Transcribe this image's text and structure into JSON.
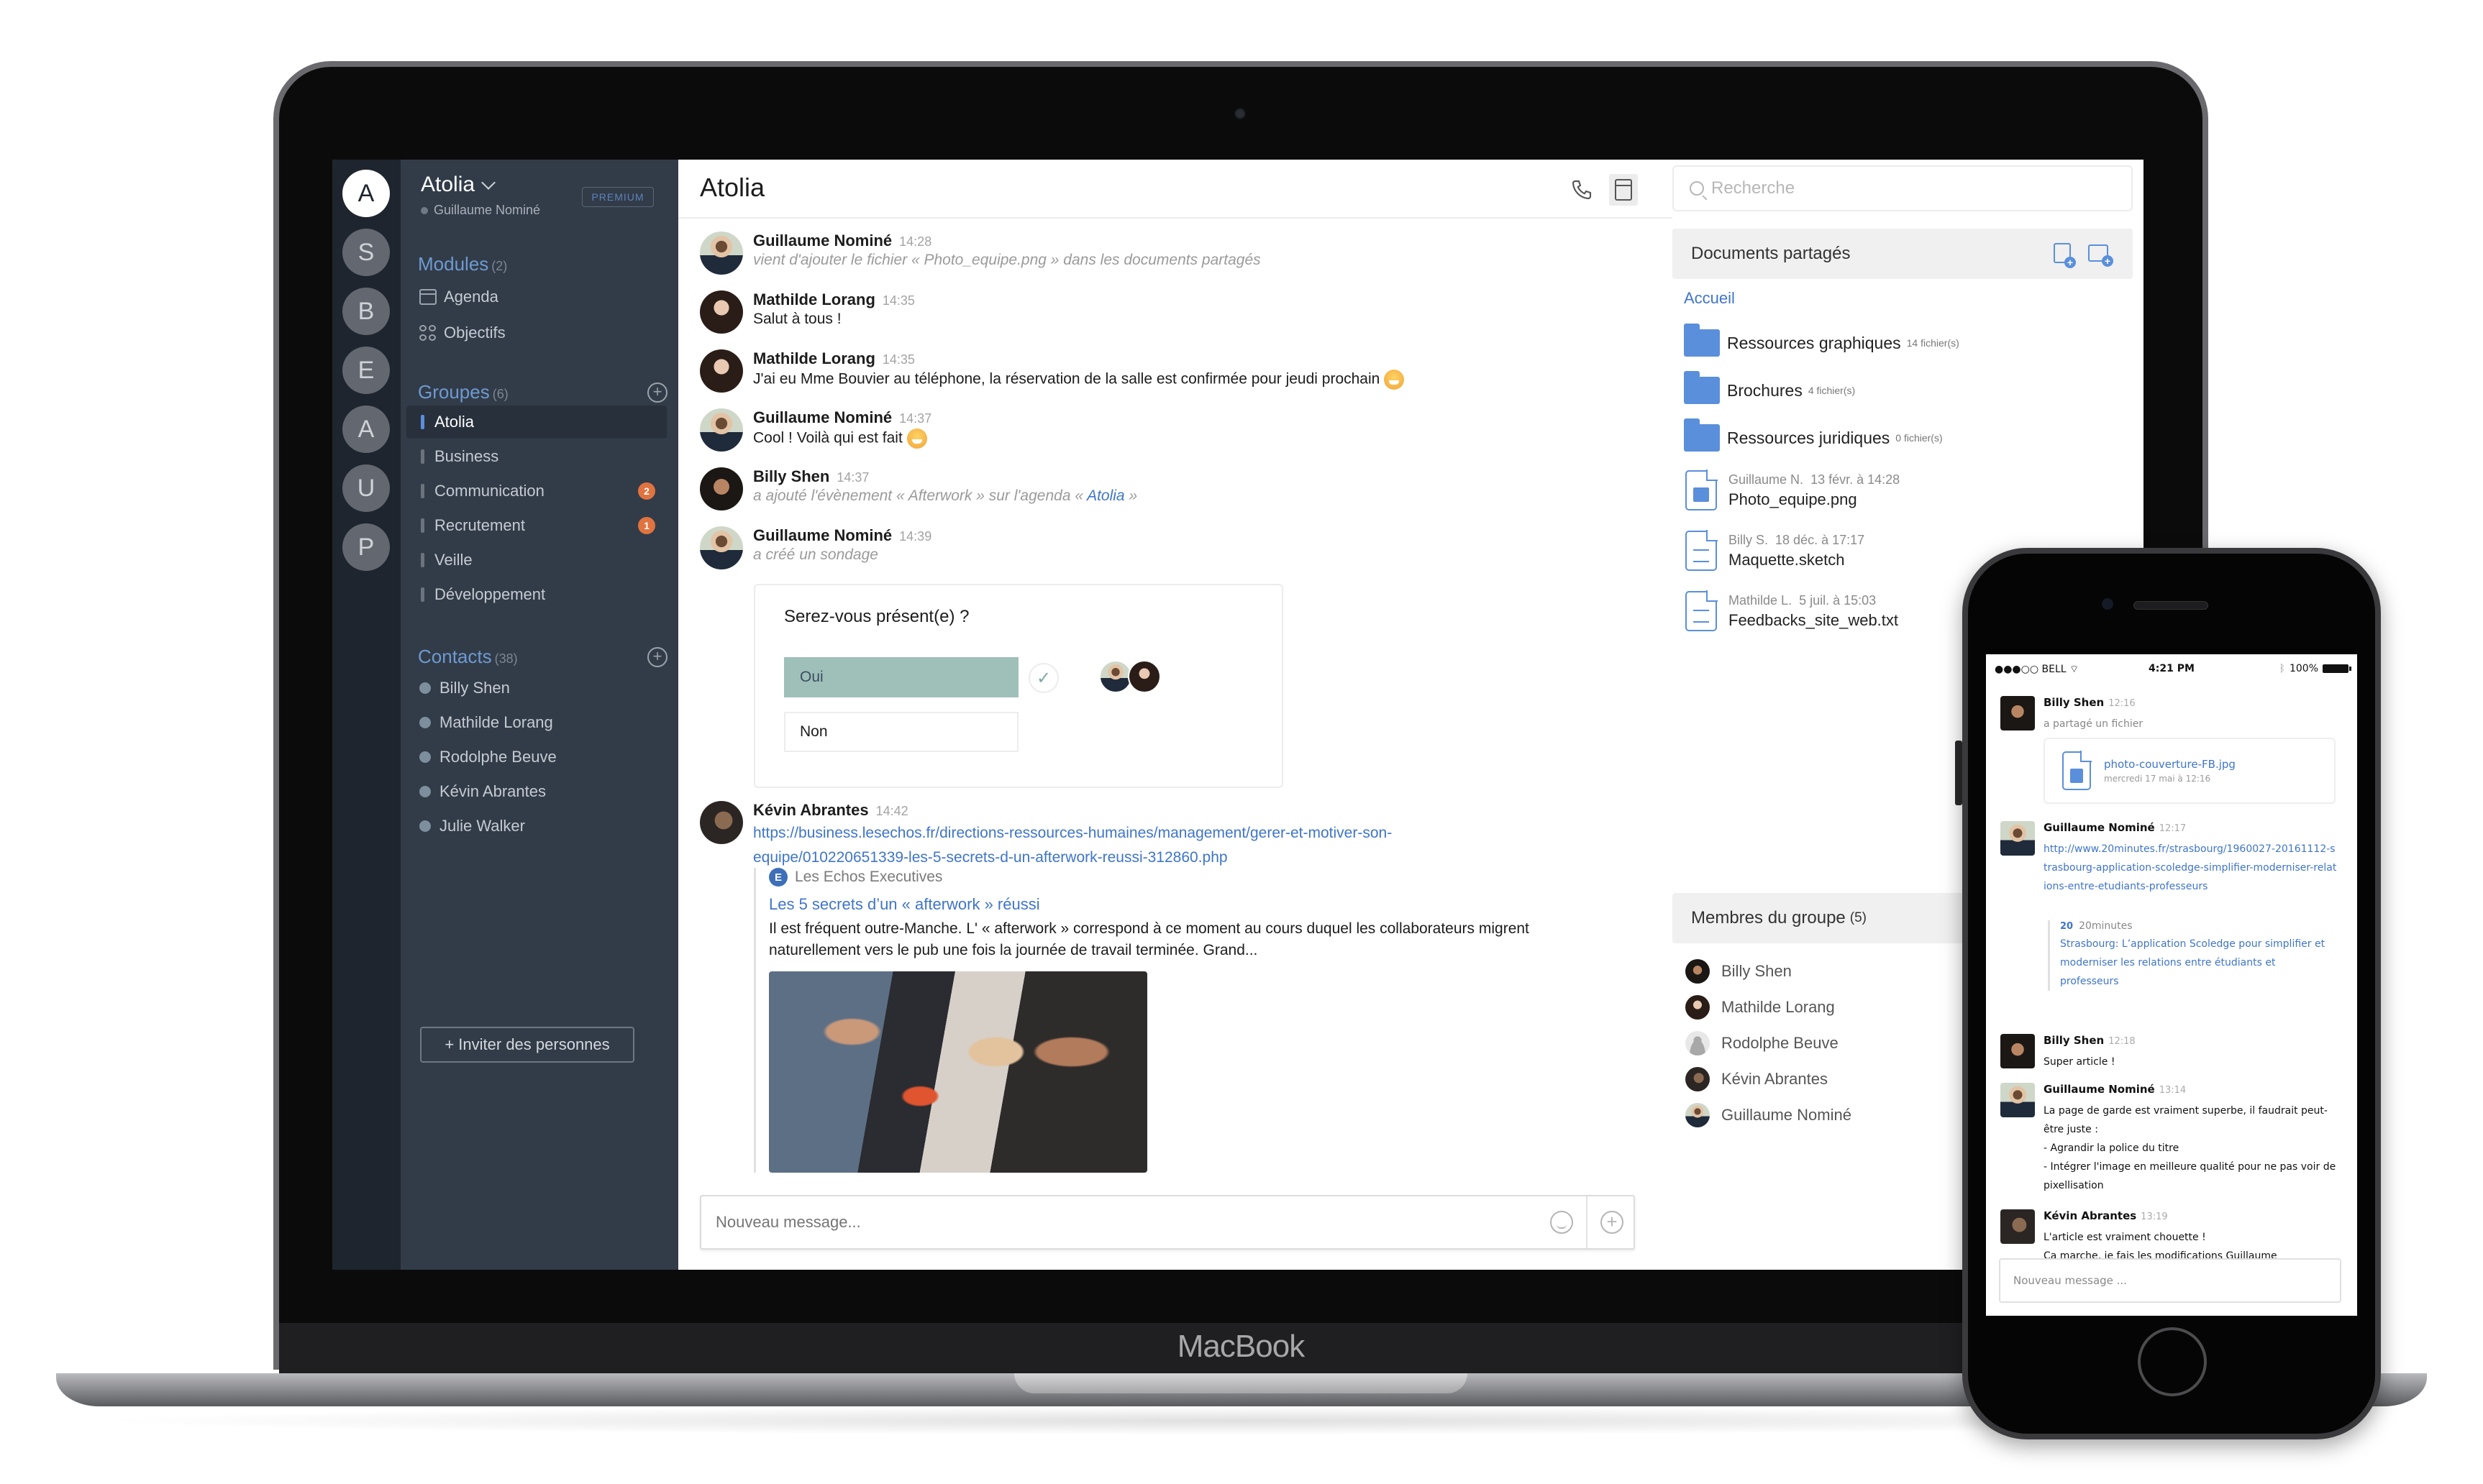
{
  "device": {
    "laptop_label": "MacBook"
  },
  "rail": {
    "workspaces": [
      "A",
      "S",
      "B",
      "E",
      "A",
      "U",
      "P"
    ],
    "active_index": 0
  },
  "sidebar": {
    "workspace_name": "Atolia",
    "user_name": "Guillaume Nominé",
    "plan_badge": "PREMIUM",
    "modules": {
      "title": "Modules",
      "count": "(2)",
      "items": [
        {
          "label": "Agenda",
          "icon": "calendar-icon"
        },
        {
          "label": "Objectifs",
          "icon": "grid-icon"
        }
      ]
    },
    "groups": {
      "title": "Groupes",
      "count": "(6)",
      "items": [
        {
          "label": "Atolia",
          "active": true,
          "badge": null
        },
        {
          "label": "Business",
          "badge": null
        },
        {
          "label": "Communication",
          "badge": "2"
        },
        {
          "label": "Recrutement",
          "badge": "1"
        },
        {
          "label": "Veille",
          "badge": null
        },
        {
          "label": "Développement",
          "badge": null
        }
      ]
    },
    "contacts": {
      "title": "Contacts",
      "count": "(38)",
      "items": [
        "Billy Shen",
        "Mathilde Lorang",
        "Rodolphe Beuve",
        "Kévin Abrantes",
        "Julie Walker"
      ]
    },
    "invite_label": "+ Inviter des personnes"
  },
  "chat": {
    "title": "Atolia",
    "messages": [
      {
        "author": "Guillaume Nominé",
        "time": "14:28",
        "text": "vient d'ajouter le fichier « Photo_equipe.png » dans les documents partagés",
        "system": true
      },
      {
        "author": "Mathilde Lorang",
        "time": "14:35",
        "text": "Salut à tous !"
      },
      {
        "author": "Mathilde Lorang",
        "time": "14:35",
        "text": "J'ai eu Mme Bouvier au téléphone, la réservation de la salle est confirmée pour jeudi prochain"
      },
      {
        "author": "Guillaume Nominé",
        "time": "14:37",
        "text": "Cool ! Voilà qui est fait"
      },
      {
        "author": "Billy Shen",
        "time": "14:37",
        "text_before": "a ajouté l'évènement « Afterwork » sur l'agenda « ",
        "link": "Atolia",
        "text_after": " »",
        "system": true
      },
      {
        "author": "Guillaume Nominé",
        "time": "14:39",
        "text": "a créé un sondage",
        "system": true
      },
      {
        "author": "Kévin Abrantes",
        "time": "14:42",
        "url_line1": "https://business.lesechos.fr/directions-ressources-humaines/management/gerer-et-motiver-son-",
        "url_line2": "equipe/010220651339-les-5-secrets-d-un-afterwork-reussi-312860.php"
      }
    ],
    "poll": {
      "question": "Serez-vous présent(e) ?",
      "options": [
        {
          "label": "Oui",
          "selected": true,
          "voters": 2
        },
        {
          "label": "Non",
          "selected": false,
          "voters": 0
        }
      ]
    },
    "link_preview": {
      "source_logo": "E",
      "source": "Les Echos Executives",
      "title": "Les 5 secrets d’un « afterwork » réussi",
      "description": "Il est fréquent outre-Manche. L' « afterwork » correspond à ce moment au cours duquel les collaborateurs migrent naturellement vers le pub une fois la journée de travail terminée. Grand..."
    },
    "composer_placeholder": "Nouveau message..."
  },
  "right_panel": {
    "search_placeholder": "Recherche",
    "documents": {
      "title": "Documents partagés",
      "breadcrumb": "Accueil",
      "folders": [
        {
          "name": "Ressources graphiques",
          "count": "14 fichier(s)"
        },
        {
          "name": "Brochures",
          "count": "4 fichier(s)"
        },
        {
          "name": "Ressources juridiques",
          "count": "0 fichier(s)"
        }
      ],
      "files": [
        {
          "author": "Guillaume N.",
          "date": "13 févr. à 14:28",
          "name": "Photo_equipe.png",
          "type": "image"
        },
        {
          "author": "Billy S.",
          "date": "18 déc. à 17:17",
          "name": "Maquette.sketch",
          "type": "text"
        },
        {
          "author": "Mathilde L.",
          "date": "5 juil. à 15:03",
          "name": "Feedbacks_site_web.txt",
          "type": "text"
        }
      ]
    },
    "members": {
      "title": "Membres du groupe",
      "count": "(5)",
      "items": [
        "Billy Shen",
        "Mathilde Lorang",
        "Rodolphe Beuve",
        "Kévin Abrantes",
        "Guillaume Nominé"
      ]
    }
  },
  "phone": {
    "status": {
      "carrier": "●●●○○ BELL",
      "time": "4:21 PM",
      "battery": "100%"
    },
    "messages": [
      {
        "author": "Billy Shen",
        "time": "12:16",
        "text": "a partagé un fichier",
        "file_name": "photo-couverture-FB.jpg",
        "file_date": "mercredi 17 mai à 12:16"
      },
      {
        "author": "Guillaume Nominé",
        "time": "12:17",
        "url": "http://www.20minutes.fr/strasbourg/1960027-20161112-strasbourg-application-scoledge-simplifier-moderniser-relations-entre-etudiants-professeurs",
        "preview_source": "20minutes",
        "preview_logo": "20",
        "preview_title": "Strasbourg: L’application Scoledge pour simplifier et moderniser les relations entre étudiants et professeurs"
      },
      {
        "author": "Billy Shen",
        "time": "12:18",
        "text": "Super article !"
      },
      {
        "author": "Guillaume Nominé",
        "time": "13:14",
        "lines": [
          "La page de garde est vraiment superbe, il faudrait peut-être juste :",
          "- Agrandir la police du titre",
          "- Intégrer l'image en meilleure qualité pour ne pas voir de pixellisation"
        ]
      },
      {
        "author": "Kévin Abrantes",
        "time": "13:19",
        "lines": [
          "L'article est vraiment chouette !",
          "Ca marche, je fais les modifications Guillaume"
        ]
      }
    ],
    "composer_placeholder": "Nouveau message ..."
  },
  "colors": {
    "sidebar_bg": "#323c49",
    "rail_bg": "#1f252e",
    "accent_blue": "#5a8fdb",
    "link_blue": "#3f75c9",
    "badge_orange": "#e0733f",
    "poll_selected": "#9fbfb9"
  }
}
